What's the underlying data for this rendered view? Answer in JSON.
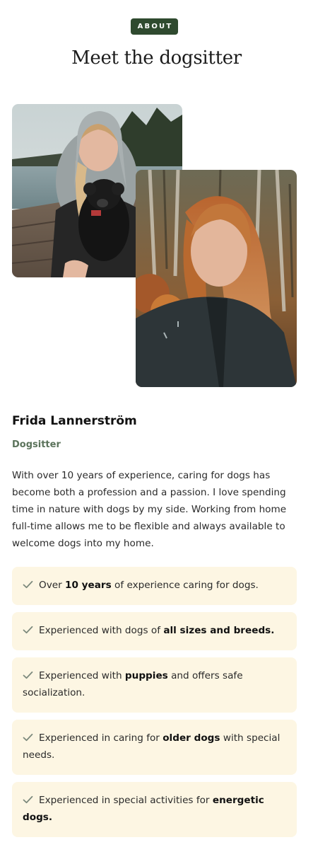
{
  "section": {
    "badge": "ABOUT",
    "title": "Meet the dogsitter"
  },
  "photos": [
    {
      "alt": "Frida holding a small black poodle on a wooden pier by the lake"
    },
    {
      "alt": "Frida smiling in a forest wearing a dark jacket"
    }
  ],
  "profile": {
    "name": "Frida Lannerström",
    "role": "Dogsitter",
    "bio": "With over 10 years of experience, caring for dogs has become both a profession and a passion. I love spending time in nature with dogs by my side. Working from home full-time allows me to be flexible and always available to welcome dogs into my home."
  },
  "features": [
    {
      "pre": "Over ",
      "bold": "10 years",
      "post": " of experience caring for dogs."
    },
    {
      "pre": "Experienced with dogs of ",
      "bold": "all sizes and breeds.",
      "post": ""
    },
    {
      "pre": "Experienced with ",
      "bold": "puppies",
      "post": " and offers safe socialization."
    },
    {
      "pre": "Experienced in caring for ",
      "bold": "older dogs",
      "post": " with special needs."
    },
    {
      "pre": "Experienced in special activities for ",
      "bold": "energetic dogs.",
      "post": ""
    }
  ],
  "colors": {
    "badge_bg": "#2f4a2f",
    "role_text": "#5b735b",
    "feature_bg": "#fdf6e3",
    "check": "#7d8a7d"
  },
  "icons": {
    "feature_check": "check-icon"
  }
}
